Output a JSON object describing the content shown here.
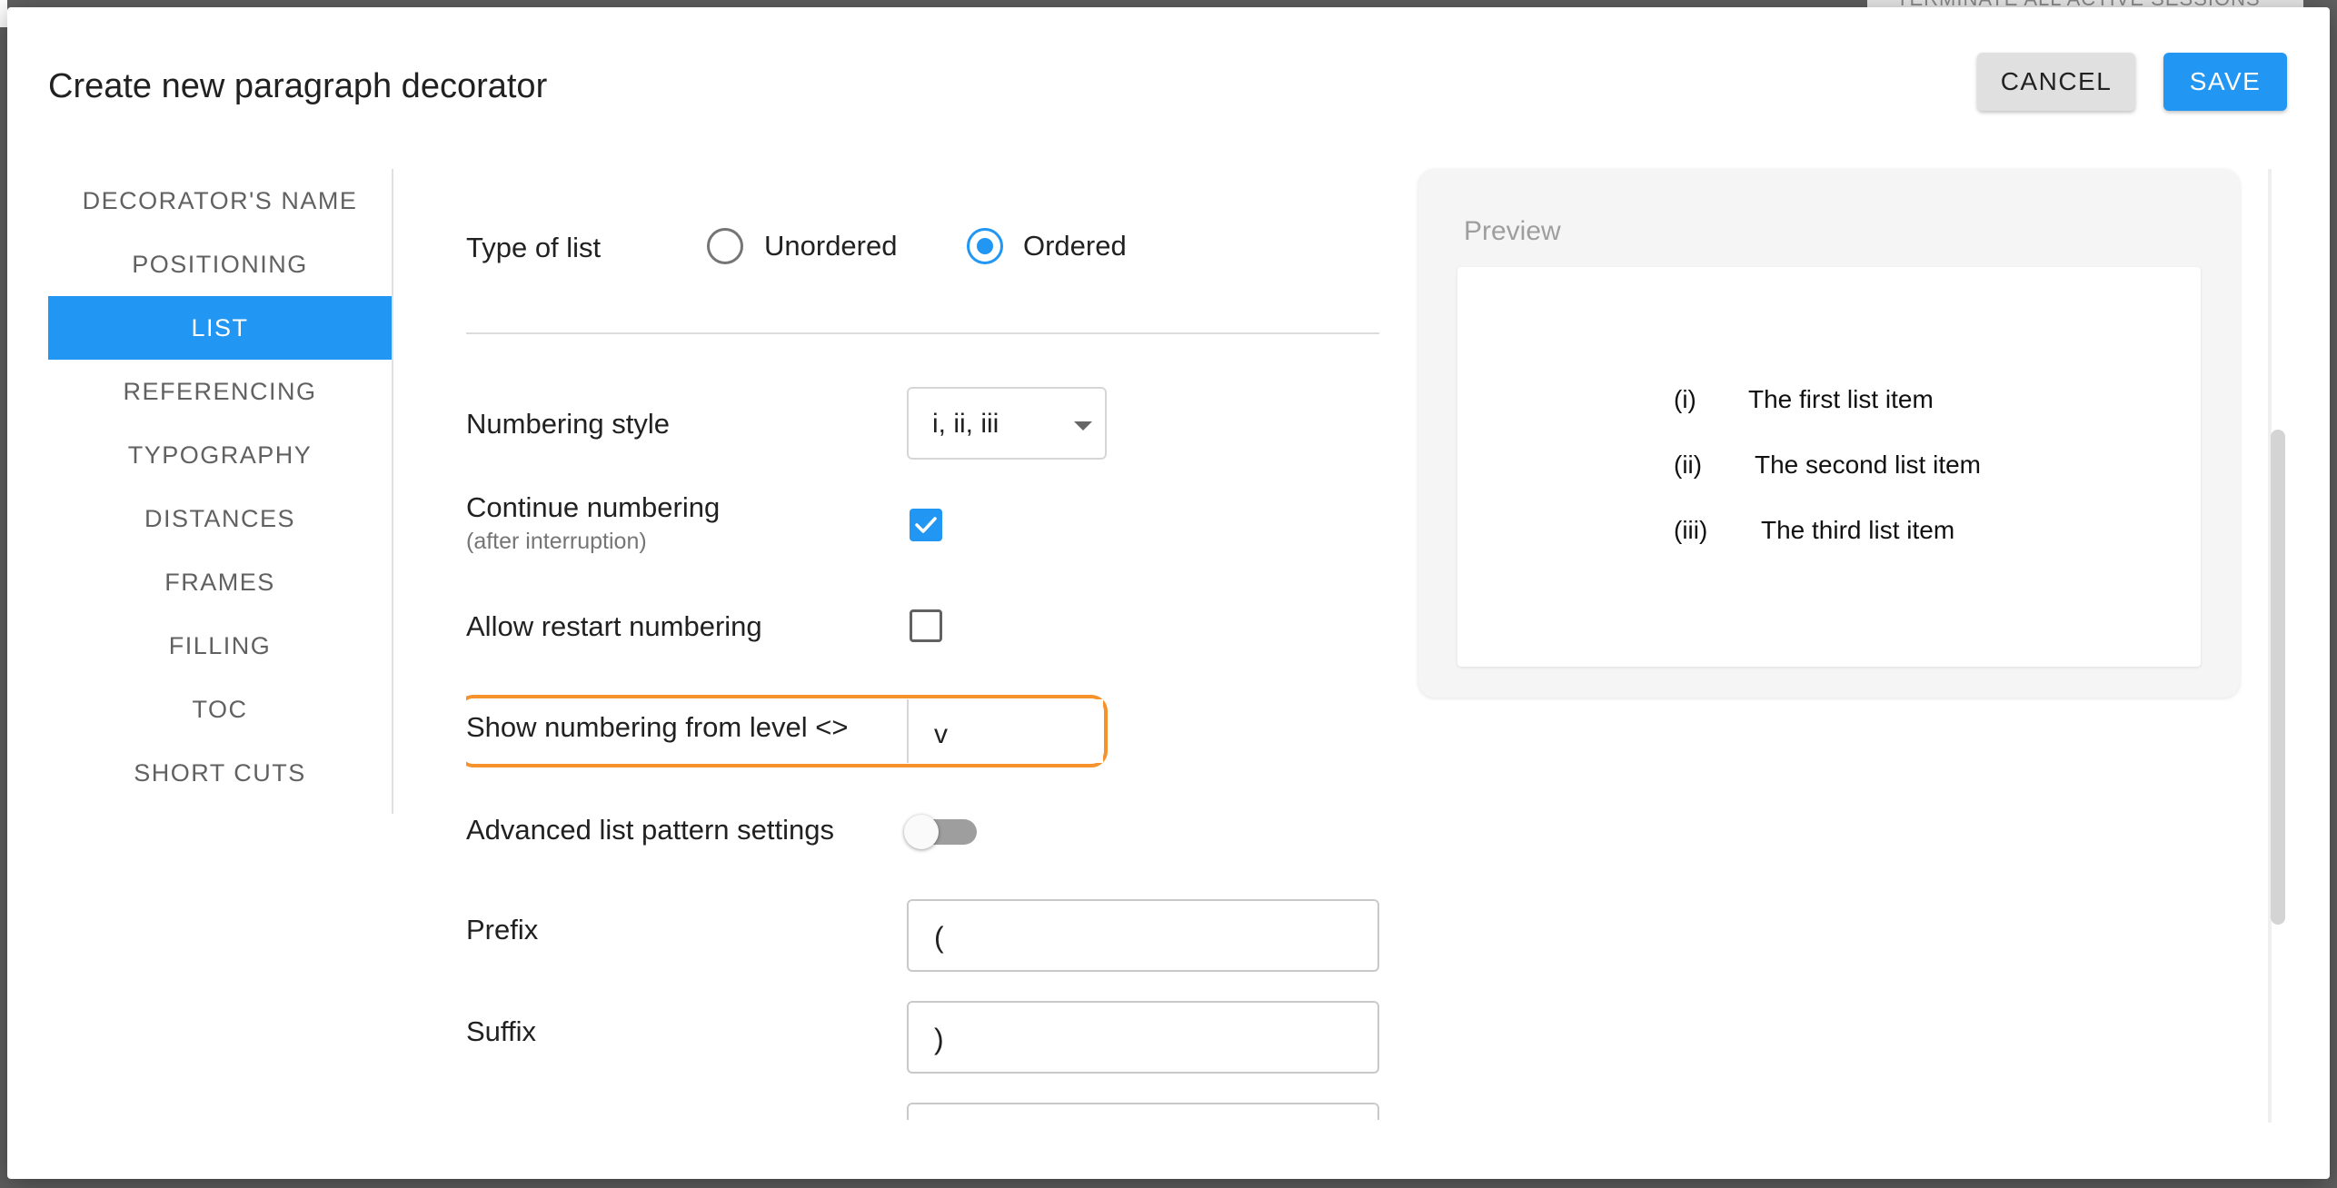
{
  "background": {
    "banner_text": "TERMINATE ALL ACTIVE SESSIONS"
  },
  "dialog": {
    "title": "Create new paragraph decorator",
    "cancel_label": "CANCEL",
    "save_label": "SAVE"
  },
  "nav": {
    "items": [
      {
        "label": "DECORATOR'S NAME",
        "active": false
      },
      {
        "label": "POSITIONING",
        "active": false
      },
      {
        "label": "LIST",
        "active": true
      },
      {
        "label": "REFERENCING",
        "active": false
      },
      {
        "label": "TYPOGRAPHY",
        "active": false
      },
      {
        "label": "DISTANCES",
        "active": false
      },
      {
        "label": "FRAMES",
        "active": false
      },
      {
        "label": "FILLING",
        "active": false
      },
      {
        "label": "TOC",
        "active": false
      },
      {
        "label": "SHORT CUTS",
        "active": false
      }
    ]
  },
  "form": {
    "type_of_list": {
      "label": "Type of list",
      "options": [
        "Unordered",
        "Ordered"
      ],
      "selected": "Ordered"
    },
    "numbering_style": {
      "label": "Numbering style",
      "value": "i, ii, iii"
    },
    "continue_numbering": {
      "label": "Continue numbering",
      "sub_label": "(after interruption)",
      "checked": true
    },
    "allow_restart": {
      "label": "Allow restart numbering",
      "checked": false
    },
    "show_from_level": {
      "label": "Show numbering from level <>",
      "value": "v"
    },
    "advanced_pattern": {
      "label": "Advanced list pattern settings",
      "enabled": false
    },
    "prefix": {
      "label": "Prefix",
      "value": "("
    },
    "suffix": {
      "label": "Suffix",
      "value": ")"
    }
  },
  "preview": {
    "title": "Preview",
    "items": [
      {
        "marker": "(i)",
        "text": "The first list item"
      },
      {
        "marker": "(ii)",
        "text": "The second list item"
      },
      {
        "marker": "(iii)",
        "text": "The third list item"
      }
    ]
  },
  "colors": {
    "accent": "#2196f3",
    "highlight": "#f5922b"
  }
}
